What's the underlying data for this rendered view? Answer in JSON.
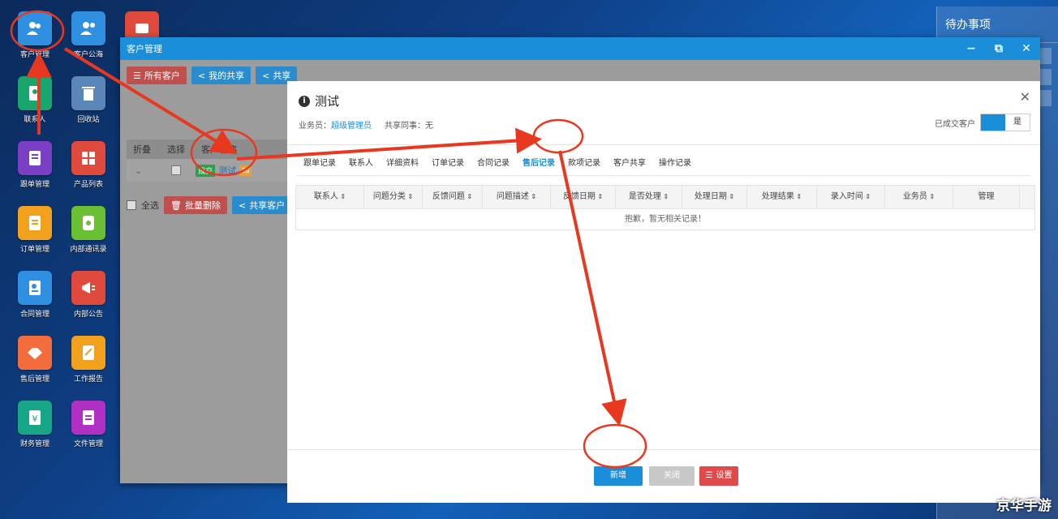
{
  "desktop": {
    "icons": [
      {
        "label": "客户管理",
        "icon": "users-icon",
        "color": "#2f8fe0"
      },
      {
        "label": "客户公海",
        "icon": "user-group-icon",
        "color": "#2f8fe0"
      },
      {
        "label": "联系人",
        "icon": "contact-book-icon",
        "color": "#18a66c"
      },
      {
        "label": "回收站",
        "icon": "trash-icon",
        "color": "#5a86b8"
      },
      {
        "label": "跟单管理",
        "icon": "notebook-icon",
        "color": "#7b3fc4"
      },
      {
        "label": "产品列表",
        "icon": "grid-icon",
        "color": "#e04a3c"
      },
      {
        "label": "订单管理",
        "icon": "document-icon",
        "color": "#f2a11c"
      },
      {
        "label": "内部通讯录",
        "icon": "phone-book-icon",
        "color": "#6bbf32"
      },
      {
        "label": "合同管理",
        "icon": "contract-icon",
        "color": "#2f8fe0"
      },
      {
        "label": "内部公告",
        "icon": "megaphone-icon",
        "color": "#e04a3c"
      },
      {
        "label": "售后管理",
        "icon": "handshake-icon",
        "color": "#f26c3c"
      },
      {
        "label": "工作报告",
        "icon": "report-icon",
        "color": "#f2a11c"
      },
      {
        "label": "财务管理",
        "icon": "yen-icon",
        "color": "#18a689"
      },
      {
        "label": "文件管理",
        "icon": "file-icon",
        "color": "#b02fc4"
      }
    ]
  },
  "todo": {
    "title": "待办事项"
  },
  "window": {
    "title": "客户管理",
    "toolbar": [
      "所有客户",
      "我的共享",
      "共享"
    ],
    "table": {
      "headers": [
        "折叠",
        "选择",
        "客户名称"
      ],
      "row": {
        "badge": "成交",
        "name": "测试"
      }
    },
    "bottom": {
      "select_all": "全选",
      "batch_delete": "批量删除",
      "share": "共享客户"
    }
  },
  "dialog": {
    "title": "测试",
    "salesman_label": "业务员：",
    "salesman": "超级管理员",
    "share_label": "共享同事：无",
    "deal_label": "已成交客户",
    "deal_value": "是",
    "tabs": [
      "跟单记录",
      "联系人",
      "详细资料",
      "订单记录",
      "合同记录",
      "售后记录",
      "款项记录",
      "客户共享",
      "操作记录"
    ],
    "active_tab": "售后记录",
    "columns": [
      "联系人",
      "问题分类",
      "反馈问题",
      "问题描述",
      "反馈日期",
      "是否处理",
      "处理日期",
      "处理结果",
      "录入时间",
      "业务员",
      "管理"
    ],
    "empty_text": "抱歉，暂无相关记录！",
    "buttons": {
      "add": "新增",
      "close": "关闭",
      "settings": "设置"
    }
  },
  "watermark": "京华手游"
}
